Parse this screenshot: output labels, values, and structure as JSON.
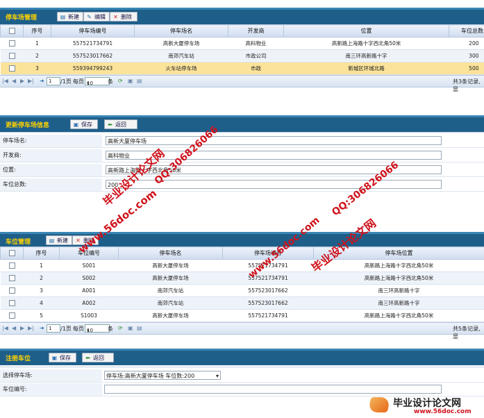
{
  "parking_mgmt": {
    "title": "停车场管理",
    "buttons": {
      "new": "新建",
      "edit": "编辑",
      "delete": "删除"
    },
    "headers": [
      "序号",
      "停车场编号",
      "停车场名",
      "开发商",
      "位置",
      "车位总数"
    ],
    "rows": [
      {
        "seq": "1",
        "code": "557521734791",
        "name": "高新大厦停车场",
        "dev": "高科物业",
        "loc": "高新路上海路十字西北角50米",
        "total": "200"
      },
      {
        "seq": "2",
        "code": "557523017662",
        "name": "南郊汽车站",
        "dev": "市政公司",
        "loc": "南三环高新路十字",
        "total": "300"
      },
      {
        "seq": "3",
        "code": "559394799243",
        "name": "火车站停车场",
        "dev": "市政",
        "loc": "新城区环城北路",
        "total": "500"
      }
    ],
    "pager": {
      "page": "1",
      "page_suffix": "/1页",
      "per_page_label": "每页",
      "per_page": "10",
      "unit": "条",
      "summary": "共3条记录, 显"
    }
  },
  "update_form": {
    "title": "更新停车场信息",
    "buttons": {
      "save": "保存",
      "back": "返回"
    },
    "fields": [
      {
        "label": "停车场名:",
        "value": "高新大厦停车场"
      },
      {
        "label": "开发商:",
        "value": "高科物业"
      },
      {
        "label": "位置:",
        "value": "高新路上海路十字西北角50米"
      },
      {
        "label": "车位总数:",
        "value": "200"
      }
    ]
  },
  "space_mgmt": {
    "title": "车位管理",
    "buttons": {
      "new": "新建",
      "delete": "删除"
    },
    "headers": [
      "序号",
      "车位编号",
      "停车场名",
      "停车场编号",
      "停车场位置"
    ],
    "rows": [
      {
        "seq": "1",
        "code": "S001",
        "lot": "高新大厦停车场",
        "lot_code": "557521734791",
        "loc": "高新路上海路十字西北角50米"
      },
      {
        "seq": "2",
        "code": "S002",
        "lot": "高新大厦停车场",
        "lot_code": "557521734791",
        "loc": "高新路上海路十字西北角50米"
      },
      {
        "seq": "3",
        "code": "A001",
        "lot": "南郊汽车站",
        "lot_code": "557523017662",
        "loc": "南三环高新路十字"
      },
      {
        "seq": "4",
        "code": "A002",
        "lot": "南郊汽车站",
        "lot_code": "557523017662",
        "loc": "南三环高新路十字"
      },
      {
        "seq": "5",
        "code": "S1003",
        "lot": "高新大厦停车场",
        "lot_code": "557521734791",
        "loc": "高新路上海路十字西北角50米"
      }
    ],
    "pager": {
      "page": "1",
      "page_suffix": "/1页",
      "per_page_label": "每页",
      "per_page": "10",
      "unit": "条",
      "summary": "共5条记录, 显"
    }
  },
  "register_form": {
    "title": "注册车位",
    "buttons": {
      "save": "保存",
      "back": "返回"
    },
    "select_label": "选择停车场:",
    "select_value": "停车场:高新大厦停车场 车位数:200",
    "code_label": "车位编号:",
    "code_value": ""
  },
  "watermarks": {
    "w1": "毕业设计论文网",
    "w2": "QQ:306826066",
    "w3": "www.56doc.com",
    "w4": "QQ:306826066",
    "w5": "毕业设计论文网",
    "w6": "www.56doc.com",
    "logo_text": "毕业设计论文网",
    "logo_url": "www.56doc.com"
  },
  "colors": {
    "title_bg": "#1e5f8a",
    "title_text": "#ffd200",
    "header_bg": "#cfdcef",
    "selected_row": "#fbe39a",
    "alt_row": "#eef3fa",
    "watermark": "#d0121b"
  }
}
